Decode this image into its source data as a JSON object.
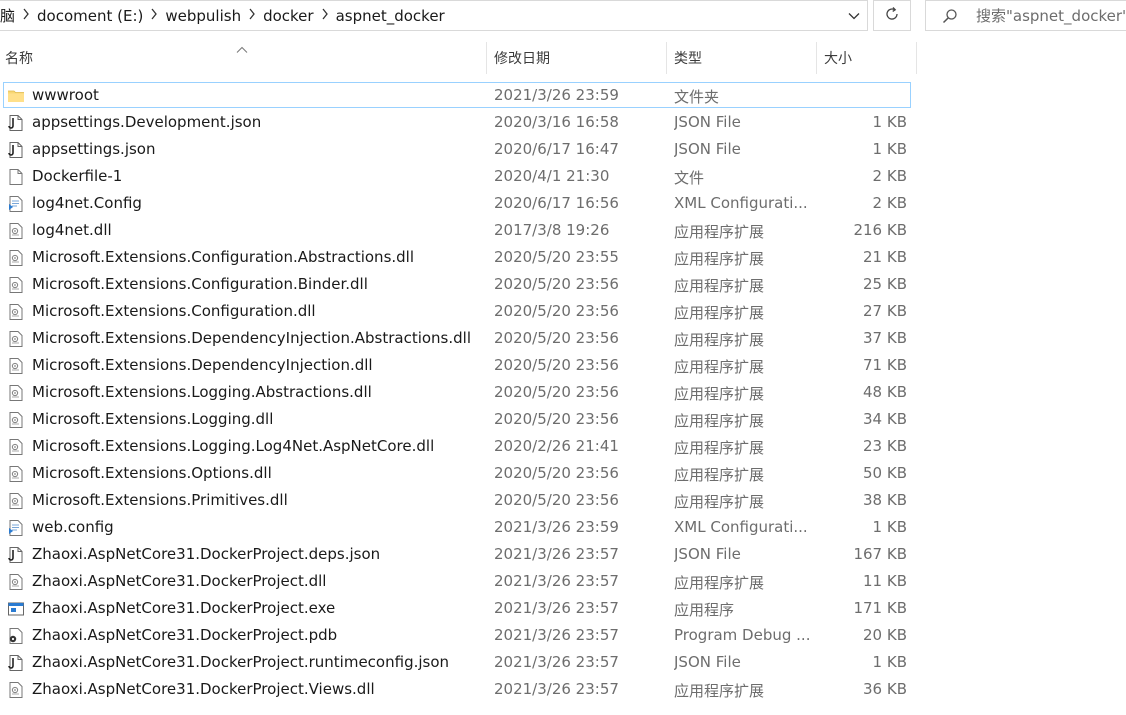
{
  "address_bar": {
    "crumbs": [
      "脑",
      "docoment (E:)",
      "webpulish",
      "docker",
      "aspnet_docker"
    ]
  },
  "search": {
    "placeholder": "搜索\"aspnet_docker\""
  },
  "columns": {
    "name": "名称",
    "date": "修改日期",
    "type": "类型",
    "size": "大小"
  },
  "files": [
    {
      "name": "wwwroot",
      "date": "2021/3/26 23:59",
      "type": "文件夹",
      "size": "",
      "icon": "folder-icon",
      "selected": true
    },
    {
      "name": "appsettings.Development.json",
      "date": "2020/3/16 16:58",
      "type": "JSON File",
      "size": "1 KB",
      "icon": "json-file-icon"
    },
    {
      "name": "appsettings.json",
      "date": "2020/6/17 16:47",
      "type": "JSON File",
      "size": "1 KB",
      "icon": "json-file-icon"
    },
    {
      "name": "Dockerfile-1",
      "date": "2020/4/1 21:30",
      "type": "文件",
      "size": "2 KB",
      "icon": "blank-file-icon"
    },
    {
      "name": "log4net.Config",
      "date": "2020/6/17 16:56",
      "type": "XML Configurati...",
      "size": "2 KB",
      "icon": "config-file-icon"
    },
    {
      "name": "log4net.dll",
      "date": "2017/3/8 19:26",
      "type": "应用程序扩展",
      "size": "216 KB",
      "icon": "dll-file-icon"
    },
    {
      "name": "Microsoft.Extensions.Configuration.Abstractions.dll",
      "date": "2020/5/20 23:55",
      "type": "应用程序扩展",
      "size": "21 KB",
      "icon": "dll-file-icon"
    },
    {
      "name": "Microsoft.Extensions.Configuration.Binder.dll",
      "date": "2020/5/20 23:56",
      "type": "应用程序扩展",
      "size": "25 KB",
      "icon": "dll-file-icon"
    },
    {
      "name": "Microsoft.Extensions.Configuration.dll",
      "date": "2020/5/20 23:56",
      "type": "应用程序扩展",
      "size": "27 KB",
      "icon": "dll-file-icon"
    },
    {
      "name": "Microsoft.Extensions.DependencyInjection.Abstractions.dll",
      "date": "2020/5/20 23:56",
      "type": "应用程序扩展",
      "size": "37 KB",
      "icon": "dll-file-icon"
    },
    {
      "name": "Microsoft.Extensions.DependencyInjection.dll",
      "date": "2020/5/20 23:56",
      "type": "应用程序扩展",
      "size": "71 KB",
      "icon": "dll-file-icon"
    },
    {
      "name": "Microsoft.Extensions.Logging.Abstractions.dll",
      "date": "2020/5/20 23:56",
      "type": "应用程序扩展",
      "size": "48 KB",
      "icon": "dll-file-icon"
    },
    {
      "name": "Microsoft.Extensions.Logging.dll",
      "date": "2020/5/20 23:56",
      "type": "应用程序扩展",
      "size": "34 KB",
      "icon": "dll-file-icon"
    },
    {
      "name": "Microsoft.Extensions.Logging.Log4Net.AspNetCore.dll",
      "date": "2020/2/26 21:41",
      "type": "应用程序扩展",
      "size": "23 KB",
      "icon": "dll-file-icon"
    },
    {
      "name": "Microsoft.Extensions.Options.dll",
      "date": "2020/5/20 23:56",
      "type": "应用程序扩展",
      "size": "50 KB",
      "icon": "dll-file-icon"
    },
    {
      "name": "Microsoft.Extensions.Primitives.dll",
      "date": "2020/5/20 23:56",
      "type": "应用程序扩展",
      "size": "38 KB",
      "icon": "dll-file-icon"
    },
    {
      "name": "web.config",
      "date": "2021/3/26 23:59",
      "type": "XML Configurati...",
      "size": "1 KB",
      "icon": "config-file-icon"
    },
    {
      "name": "Zhaoxi.AspNetCore31.DockerProject.deps.json",
      "date": "2021/3/26 23:57",
      "type": "JSON File",
      "size": "167 KB",
      "icon": "json-file-icon"
    },
    {
      "name": "Zhaoxi.AspNetCore31.DockerProject.dll",
      "date": "2021/3/26 23:57",
      "type": "应用程序扩展",
      "size": "11 KB",
      "icon": "dll-file-icon"
    },
    {
      "name": "Zhaoxi.AspNetCore31.DockerProject.exe",
      "date": "2021/3/26 23:57",
      "type": "应用程序",
      "size": "171 KB",
      "icon": "exe-file-icon"
    },
    {
      "name": "Zhaoxi.AspNetCore31.DockerProject.pdb",
      "date": "2021/3/26 23:57",
      "type": "Program Debug ...",
      "size": "20 KB",
      "icon": "pdb-file-icon"
    },
    {
      "name": "Zhaoxi.AspNetCore31.DockerProject.runtimeconfig.json",
      "date": "2021/3/26 23:57",
      "type": "JSON File",
      "size": "1 KB",
      "icon": "json-file-icon"
    },
    {
      "name": "Zhaoxi.AspNetCore31.DockerProject.Views.dll",
      "date": "2021/3/26 23:57",
      "type": "应用程序扩展",
      "size": "36 KB",
      "icon": "dll-file-icon"
    }
  ]
}
